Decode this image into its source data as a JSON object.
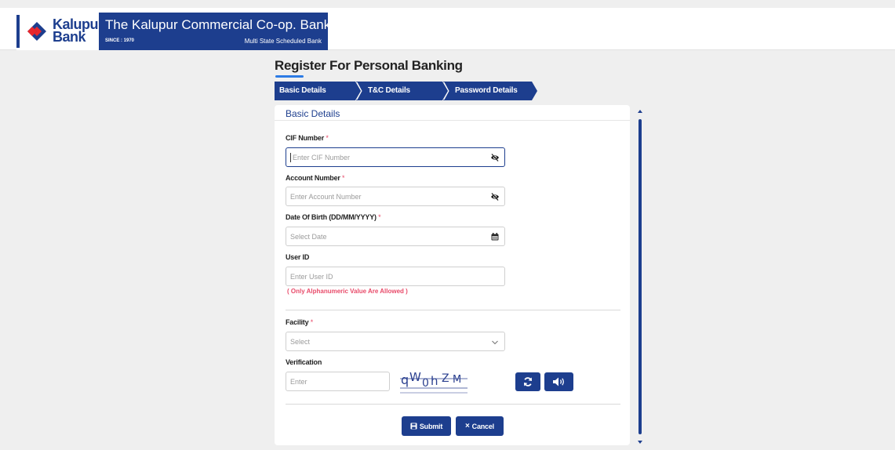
{
  "header": {
    "logo_line1": "Kalupur",
    "logo_line2": "Bank",
    "bank_name": "The Kalupur Commercial Co-op. Bank Ltd.",
    "since": "SINCE : 1970",
    "tagline": "Multi State Scheduled Bank"
  },
  "page": {
    "title": "Register For Personal Banking"
  },
  "steps": [
    {
      "label": "Basic Details",
      "active": true
    },
    {
      "label": "T&C Details",
      "active": false
    },
    {
      "label": "Password Details",
      "active": false
    }
  ],
  "card": {
    "title": "Basic Details"
  },
  "form": {
    "cif": {
      "label": "CIF Number",
      "placeholder": "Enter CIF Number",
      "required_mark": "*",
      "icon": "eye-slash-icon"
    },
    "account": {
      "label": "Account Number",
      "placeholder": "Enter Account Number",
      "required_mark": "*",
      "icon": "eye-slash-icon"
    },
    "dob": {
      "label": "Date Of Birth (DD/MM/YYYY)",
      "placeholder": "Select Date",
      "required_mark": "*",
      "icon": "calendar-icon"
    },
    "userid": {
      "label": "User ID",
      "placeholder": "Enter User ID",
      "hint": "( Only Alphanumeric Value Are Allowed )"
    },
    "facility": {
      "label": "Facility",
      "placeholder": "Select",
      "required_mark": "*",
      "icon": "chevron-down-icon"
    },
    "verification": {
      "label": "Verification",
      "placeholder": "Enter",
      "captcha_text": "qW0hZM"
    }
  },
  "buttons": {
    "submit": "Submit",
    "cancel": "Cancel",
    "refresh_icon": "refresh-icon",
    "audio_icon": "speaker-icon"
  },
  "colors": {
    "brand": "#1d3e8e",
    "accent": "#2c7be5",
    "error": "#e84b6a",
    "background": "#efefef"
  }
}
